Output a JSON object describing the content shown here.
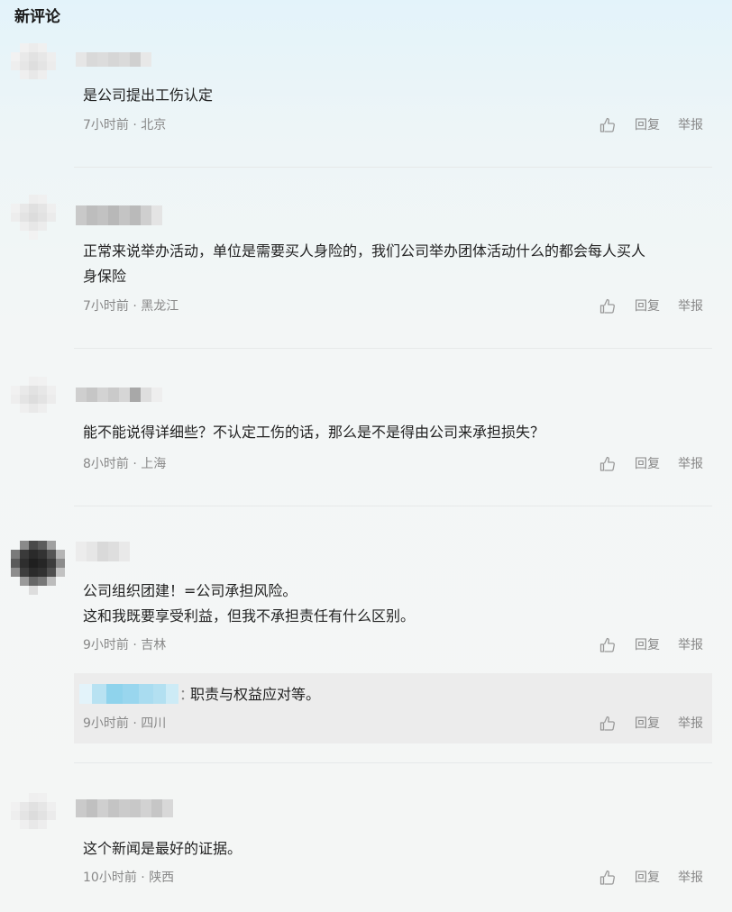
{
  "section": {
    "title": "新评论"
  },
  "actions": {
    "reply": "回复",
    "report": "举报",
    "like_icon": "thumbs-up-icon"
  },
  "comments": [
    {
      "text": "是公司提出工伤认定",
      "time": "7小时前",
      "sep": " · ",
      "location": "北京"
    },
    {
      "text": "正常来说举办活动，单位是需要买人身险的，我们公司举办团体活动什么的都会每人买人\n身保险",
      "time": "7小时前",
      "sep": " · ",
      "location": "黑龙江"
    },
    {
      "text": "能不能说得详细些？不认定工伤的话，那么是不是得由公司来承担损失？",
      "time": "8小时前",
      "sep": " · ",
      "location": "上海"
    },
    {
      "text": "公司组织团建！=公司承担风险。\n这和我既要享受利益，但我不承担责任有什么区别。",
      "time": "9小时前",
      "sep": " · ",
      "location": "吉林",
      "reply": {
        "colon": "：",
        "text": "职责与权益应对等。",
        "time": "9小时前",
        "sep": " · ",
        "location": "四川"
      }
    },
    {
      "text": "这个新闻是最好的证据。",
      "time": "10小时前",
      "sep": " · ",
      "location": "陕西"
    }
  ],
  "colors": {
    "text": "#222222",
    "meta": "#888888",
    "reply_bg": "#ececec",
    "reply_name_blur": "#8fd3ec"
  }
}
